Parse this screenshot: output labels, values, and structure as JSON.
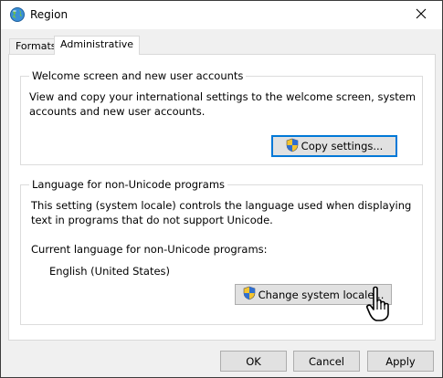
{
  "window": {
    "title": "Region"
  },
  "tabs": [
    {
      "label": "Formats",
      "selected": false
    },
    {
      "label": "Administrative",
      "selected": true
    }
  ],
  "welcome_group": {
    "title": "Welcome screen and new user accounts",
    "description_line1": "View and copy your international settings to the welcome screen, system",
    "description_line2": "accounts and new user accounts.",
    "copy_button": "Copy settings..."
  },
  "language_group": {
    "title": "Language for non-Unicode programs",
    "description_line1": "This setting (system locale) controls the language used when displaying",
    "description_line2": "text in programs that do not support Unicode.",
    "current_label": "Current language for non-Unicode programs:",
    "current_value": "English (United States)",
    "change_button": "Change system locale..."
  },
  "footer": {
    "ok": "OK",
    "cancel": "Cancel",
    "apply": "Apply"
  },
  "icons": {
    "app": "globe-icon",
    "close": "close-icon",
    "shield": "uac-shield-icon",
    "cursor": "hand-pointer-icon"
  },
  "colors": {
    "focus_border": "#0078d7",
    "button_face": "#e1e1e1",
    "window_bg": "#f0f0f0"
  }
}
